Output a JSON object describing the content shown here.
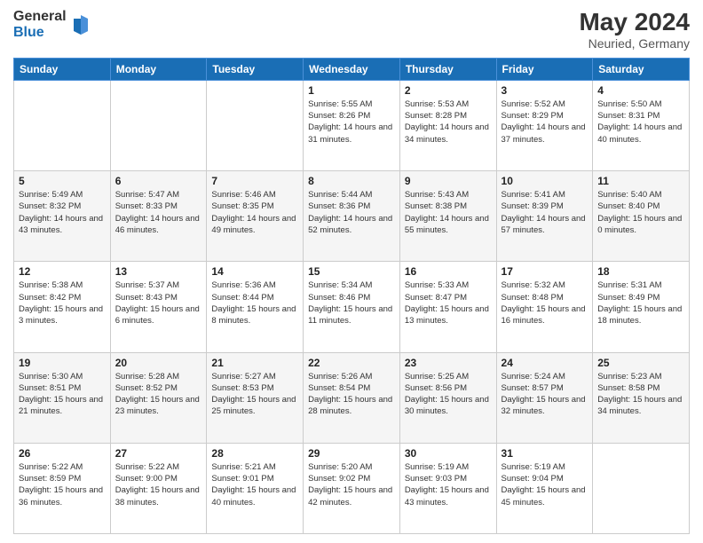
{
  "header": {
    "logo_general": "General",
    "logo_blue": "Blue",
    "title": "May 2024",
    "subtitle": "Neuried, Germany"
  },
  "calendar": {
    "days_of_week": [
      "Sunday",
      "Monday",
      "Tuesday",
      "Wednesday",
      "Thursday",
      "Friday",
      "Saturday"
    ],
    "weeks": [
      [
        {
          "day": "",
          "info": ""
        },
        {
          "day": "",
          "info": ""
        },
        {
          "day": "",
          "info": ""
        },
        {
          "day": "1",
          "info": "Sunrise: 5:55 AM\nSunset: 8:26 PM\nDaylight: 14 hours\nand 31 minutes."
        },
        {
          "day": "2",
          "info": "Sunrise: 5:53 AM\nSunset: 8:28 PM\nDaylight: 14 hours\nand 34 minutes."
        },
        {
          "day": "3",
          "info": "Sunrise: 5:52 AM\nSunset: 8:29 PM\nDaylight: 14 hours\nand 37 minutes."
        },
        {
          "day": "4",
          "info": "Sunrise: 5:50 AM\nSunset: 8:31 PM\nDaylight: 14 hours\nand 40 minutes."
        }
      ],
      [
        {
          "day": "5",
          "info": "Sunrise: 5:49 AM\nSunset: 8:32 PM\nDaylight: 14 hours\nand 43 minutes."
        },
        {
          "day": "6",
          "info": "Sunrise: 5:47 AM\nSunset: 8:33 PM\nDaylight: 14 hours\nand 46 minutes."
        },
        {
          "day": "7",
          "info": "Sunrise: 5:46 AM\nSunset: 8:35 PM\nDaylight: 14 hours\nand 49 minutes."
        },
        {
          "day": "8",
          "info": "Sunrise: 5:44 AM\nSunset: 8:36 PM\nDaylight: 14 hours\nand 52 minutes."
        },
        {
          "day": "9",
          "info": "Sunrise: 5:43 AM\nSunset: 8:38 PM\nDaylight: 14 hours\nand 55 minutes."
        },
        {
          "day": "10",
          "info": "Sunrise: 5:41 AM\nSunset: 8:39 PM\nDaylight: 14 hours\nand 57 minutes."
        },
        {
          "day": "11",
          "info": "Sunrise: 5:40 AM\nSunset: 8:40 PM\nDaylight: 15 hours\nand 0 minutes."
        }
      ],
      [
        {
          "day": "12",
          "info": "Sunrise: 5:38 AM\nSunset: 8:42 PM\nDaylight: 15 hours\nand 3 minutes."
        },
        {
          "day": "13",
          "info": "Sunrise: 5:37 AM\nSunset: 8:43 PM\nDaylight: 15 hours\nand 6 minutes."
        },
        {
          "day": "14",
          "info": "Sunrise: 5:36 AM\nSunset: 8:44 PM\nDaylight: 15 hours\nand 8 minutes."
        },
        {
          "day": "15",
          "info": "Sunrise: 5:34 AM\nSunset: 8:46 PM\nDaylight: 15 hours\nand 11 minutes."
        },
        {
          "day": "16",
          "info": "Sunrise: 5:33 AM\nSunset: 8:47 PM\nDaylight: 15 hours\nand 13 minutes."
        },
        {
          "day": "17",
          "info": "Sunrise: 5:32 AM\nSunset: 8:48 PM\nDaylight: 15 hours\nand 16 minutes."
        },
        {
          "day": "18",
          "info": "Sunrise: 5:31 AM\nSunset: 8:49 PM\nDaylight: 15 hours\nand 18 minutes."
        }
      ],
      [
        {
          "day": "19",
          "info": "Sunrise: 5:30 AM\nSunset: 8:51 PM\nDaylight: 15 hours\nand 21 minutes."
        },
        {
          "day": "20",
          "info": "Sunrise: 5:28 AM\nSunset: 8:52 PM\nDaylight: 15 hours\nand 23 minutes."
        },
        {
          "day": "21",
          "info": "Sunrise: 5:27 AM\nSunset: 8:53 PM\nDaylight: 15 hours\nand 25 minutes."
        },
        {
          "day": "22",
          "info": "Sunrise: 5:26 AM\nSunset: 8:54 PM\nDaylight: 15 hours\nand 28 minutes."
        },
        {
          "day": "23",
          "info": "Sunrise: 5:25 AM\nSunset: 8:56 PM\nDaylight: 15 hours\nand 30 minutes."
        },
        {
          "day": "24",
          "info": "Sunrise: 5:24 AM\nSunset: 8:57 PM\nDaylight: 15 hours\nand 32 minutes."
        },
        {
          "day": "25",
          "info": "Sunrise: 5:23 AM\nSunset: 8:58 PM\nDaylight: 15 hours\nand 34 minutes."
        }
      ],
      [
        {
          "day": "26",
          "info": "Sunrise: 5:22 AM\nSunset: 8:59 PM\nDaylight: 15 hours\nand 36 minutes."
        },
        {
          "day": "27",
          "info": "Sunrise: 5:22 AM\nSunset: 9:00 PM\nDaylight: 15 hours\nand 38 minutes."
        },
        {
          "day": "28",
          "info": "Sunrise: 5:21 AM\nSunset: 9:01 PM\nDaylight: 15 hours\nand 40 minutes."
        },
        {
          "day": "29",
          "info": "Sunrise: 5:20 AM\nSunset: 9:02 PM\nDaylight: 15 hours\nand 42 minutes."
        },
        {
          "day": "30",
          "info": "Sunrise: 5:19 AM\nSunset: 9:03 PM\nDaylight: 15 hours\nand 43 minutes."
        },
        {
          "day": "31",
          "info": "Sunrise: 5:19 AM\nSunset: 9:04 PM\nDaylight: 15 hours\nand 45 minutes."
        },
        {
          "day": "",
          "info": ""
        }
      ]
    ]
  }
}
